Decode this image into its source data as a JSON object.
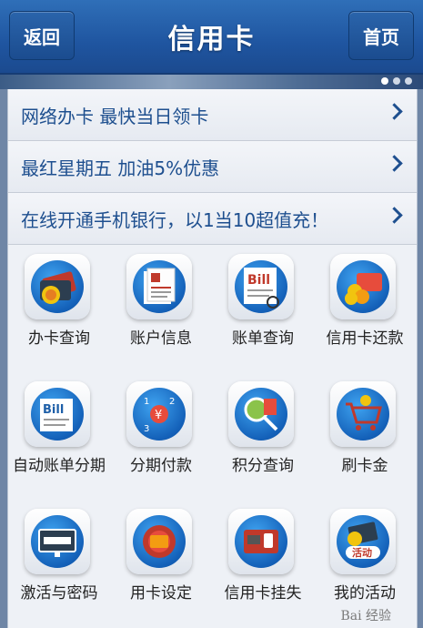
{
  "header": {
    "back_label": "返回",
    "title": "信用卡",
    "home_label": "首页"
  },
  "promos": [
    {
      "text": "网络办卡 最快当日领卡"
    },
    {
      "text": "最红星期五 加油5%优惠"
    },
    {
      "text": "在线开通手机银行，以1当10超值充！"
    }
  ],
  "menu": [
    {
      "label": "办卡查询",
      "icon": "card-apply-icon"
    },
    {
      "label": "账户信息",
      "icon": "account-info-icon"
    },
    {
      "label": "账单查询",
      "icon": "bill-query-icon"
    },
    {
      "label": "信用卡还款",
      "icon": "repayment-icon"
    },
    {
      "label": "自动账单分期",
      "icon": "auto-installment-icon"
    },
    {
      "label": "分期付款",
      "icon": "installment-icon"
    },
    {
      "label": "积分查询",
      "icon": "points-query-icon"
    },
    {
      "label": "刷卡金",
      "icon": "shopping-cart-icon"
    },
    {
      "label": "激活与密码",
      "icon": "activation-password-icon"
    },
    {
      "label": "用卡设定",
      "icon": "card-settings-icon"
    },
    {
      "label": "信用卡挂失",
      "icon": "report-loss-icon"
    },
    {
      "label": "我的活动",
      "icon": "my-activities-icon"
    }
  ],
  "icon_text": {
    "bill": "Bill",
    "bill2": "Bill",
    "activity": "活动",
    "yen": "¥",
    "step1": "1",
    "step2": "2",
    "step3": "3"
  },
  "watermark": "Bai 经验"
}
